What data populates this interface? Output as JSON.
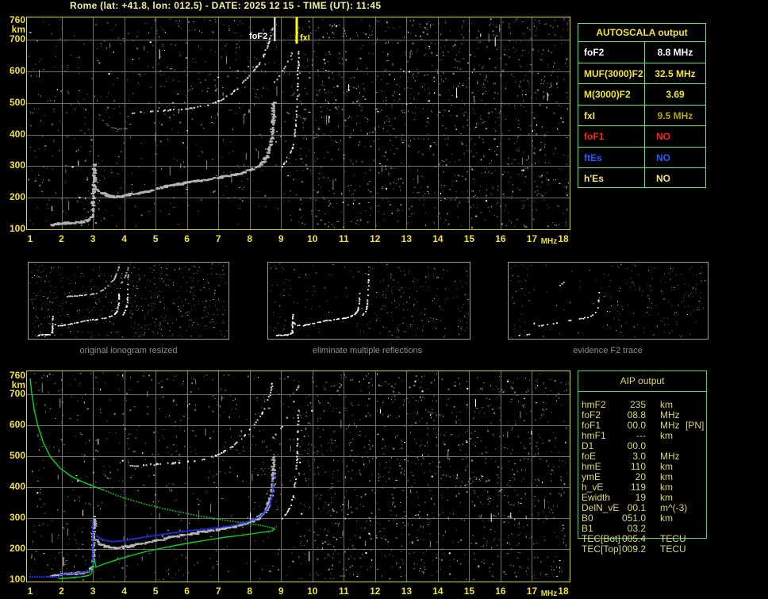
{
  "title": "Rome (lat: +41.8, lon: 012.5) - DATE: 2025 12 15 - TIME (UT): 11:45",
  "colors": {
    "tick_yellow": "#f0e23a",
    "title_yellow": "#f5f1a2",
    "plot_border": "#d8d800",
    "grid": "#6f6f6f",
    "white": "#ffffff",
    "red": "#ff2020",
    "blue": "#2060ff",
    "olive_value": "#b4a800",
    "pale_yellow": "#f0e87c",
    "khaki": "#d9d973",
    "green_curve": "#00d81e",
    "blue_trace": "#2233ee",
    "noise_gray": "#767676",
    "noise_light": "#9c9c9c",
    "caption_gray": "#8f8f8f",
    "thumb_border": "#9a9a9a",
    "autoscala_border": "#57e57c",
    "aip_border": "#3fdd6f",
    "marker_foF2": "#ffffff",
    "marker_fxI": "#ffff00"
  },
  "axes": {
    "freq_unit": "MHz",
    "height_unit": "km",
    "freq_ticks": [
      "1",
      "2",
      "3",
      "4",
      "5",
      "6",
      "7",
      "8",
      "9",
      "10",
      "11",
      "12",
      "13",
      "14",
      "15",
      "16",
      "17",
      "18"
    ],
    "height_ticks": [
      "760",
      "700",
      "600",
      "500",
      "400",
      "300",
      "200",
      "100"
    ],
    "freq_range_MHz": [
      1,
      18
    ],
    "height_range_km": [
      100,
      760
    ]
  },
  "top_plot": {
    "foF2_marker_label": "foF2",
    "fxI_marker_label": "fxI",
    "foF2_MHz": 8.8,
    "fxI_MHz": 9.5
  },
  "autoscala_table": {
    "title": "AUTOSCALA output",
    "rows": [
      {
        "label": "foF2",
        "value": "8.8 MHz",
        "label_color": "#ffffff",
        "value_color": "#ffffff",
        "no": false
      },
      {
        "label": "MUF(3000)F2",
        "value": "32.5 MHz",
        "label_color": "#f2e43a",
        "value_color": "#f2e43a",
        "no": false
      },
      {
        "label": "M(3000)F2",
        "value": "3.69",
        "label_color": "#f2e43a",
        "value_color": "#f2e43a",
        "no": false
      },
      {
        "label": "fxI",
        "value": "9.5 MHz",
        "label_color": "#f2e43a",
        "value_color": "#b4a800",
        "no": false
      },
      {
        "label": "foF1",
        "value": "NO",
        "label_color": "#ff2020",
        "value_color": "#ff2020",
        "no": true
      },
      {
        "label": "ftEs",
        "value": "NO",
        "label_color": "#2060ff",
        "value_color": "#2060ff",
        "no": true
      },
      {
        "label": "h'Es",
        "value": "NO",
        "label_color": "#f0e87c",
        "value_color": "#f0e87c",
        "no": true
      }
    ]
  },
  "thumbnails": [
    {
      "caption": "original ionogram resized"
    },
    {
      "caption": "eliminate multiple reflections"
    },
    {
      "caption": "evidence F2 trace"
    }
  ],
  "aip_table": {
    "title": "AIP output",
    "rows": [
      {
        "label": "hmF2",
        "value": "235",
        "unit": "km",
        "note": ""
      },
      {
        "label": "foF2",
        "value": "08.8",
        "unit": "MHz",
        "note": ""
      },
      {
        "label": "foF1",
        "value": "00.0",
        "unit": "MHz",
        "note": "[PN]"
      },
      {
        "label": "hmF1",
        "value": "---",
        "unit": "km",
        "note": ""
      },
      {
        "label": "D1",
        "value": "00.0",
        "unit": "",
        "note": ""
      },
      {
        "label": "foE",
        "value": "3.0",
        "unit": "MHz",
        "note": ""
      },
      {
        "label": "hmE",
        "value": "110",
        "unit": "km",
        "note": ""
      },
      {
        "label": "ymE",
        "value": "20",
        "unit": "km",
        "note": ""
      },
      {
        "label": "h_vE",
        "value": "119",
        "unit": "km",
        "note": ""
      },
      {
        "label": "Ewidth",
        "value": "19",
        "unit": "km",
        "note": ""
      },
      {
        "label": "DelN_vE",
        "value": "00.1",
        "unit": "m^(-3)",
        "note": ""
      },
      {
        "label": "B0",
        "value": "051.0",
        "unit": "km",
        "note": ""
      },
      {
        "label": "B1",
        "value": "03.2",
        "unit": "",
        "note": ""
      },
      {
        "label": "TEC[Bot]",
        "value": "005.4",
        "unit": "TECU",
        "note": ""
      },
      {
        "label": "TEC[Top]",
        "value": "009.2",
        "unit": "TECU",
        "note": ""
      }
    ]
  },
  "ionogram_traces": {
    "E": [
      [
        1.7,
        112
      ],
      [
        1.85,
        117
      ],
      [
        2.1,
        119
      ],
      [
        2.4,
        121
      ],
      [
        2.65,
        122
      ],
      [
        2.85,
        127
      ],
      [
        2.95,
        140
      ]
    ],
    "cusp": [
      [
        3.01,
        142
      ],
      [
        3.02,
        185
      ],
      [
        3.03,
        235
      ],
      [
        3.05,
        280
      ],
      [
        3.07,
        306
      ]
    ],
    "F": [
      [
        3.1,
        232
      ],
      [
        3.25,
        216
      ],
      [
        3.45,
        207
      ],
      [
        3.7,
        203
      ],
      [
        3.95,
        205
      ],
      [
        4.2,
        210
      ],
      [
        4.6,
        218
      ],
      [
        5.0,
        227
      ],
      [
        5.4,
        236
      ],
      [
        5.8,
        244
      ],
      [
        6.2,
        251
      ],
      [
        6.6,
        257
      ],
      [
        7.0,
        263
      ],
      [
        7.4,
        270
      ],
      [
        7.8,
        280
      ],
      [
        8.1,
        291
      ],
      [
        8.35,
        305
      ],
      [
        8.52,
        323
      ],
      [
        8.63,
        347
      ],
      [
        8.7,
        380
      ],
      [
        8.74,
        420
      ],
      [
        8.76,
        462
      ],
      [
        8.77,
        500
      ]
    ],
    "FX": [
      [
        9.05,
        300
      ],
      [
        9.2,
        318
      ],
      [
        9.32,
        343
      ],
      [
        9.41,
        378
      ],
      [
        9.47,
        425
      ],
      [
        9.51,
        480
      ],
      [
        9.53,
        540
      ],
      [
        9.55,
        608
      ],
      [
        9.56,
        662
      ]
    ],
    "hop2O": [
      [
        4.2,
        468
      ],
      [
        4.7,
        472
      ],
      [
        5.2,
        475
      ],
      [
        5.7,
        479
      ],
      [
        6.1,
        483
      ],
      [
        6.5,
        489
      ],
      [
        6.8,
        497
      ],
      [
        7.1,
        510
      ],
      [
        7.4,
        528
      ],
      [
        7.7,
        553
      ],
      [
        8.0,
        585
      ],
      [
        8.3,
        622
      ],
      [
        8.5,
        660
      ],
      [
        8.65,
        700
      ],
      [
        8.72,
        735
      ]
    ],
    "hop2X": [
      [
        8.75,
        560
      ],
      [
        8.95,
        585
      ],
      [
        9.15,
        615
      ],
      [
        9.32,
        650
      ],
      [
        9.45,
        690
      ],
      [
        9.55,
        728
      ]
    ],
    "hop2E": [
      [
        3.2,
        462
      ],
      [
        3.35,
        440
      ],
      [
        3.55,
        425
      ],
      [
        3.8,
        416
      ],
      [
        4.05,
        418
      ],
      [
        4.2,
        432
      ]
    ]
  },
  "profile_curves": {
    "upper_solid": [
      [
        1.0,
        752
      ],
      [
        1.05,
        705
      ],
      [
        1.13,
        652
      ],
      [
        1.25,
        598
      ],
      [
        1.42,
        545
      ],
      [
        1.65,
        498
      ],
      [
        1.95,
        462
      ],
      [
        2.3,
        436
      ],
      [
        2.7,
        416
      ],
      [
        3.1,
        400
      ],
      [
        3.35,
        391
      ]
    ],
    "upper_dotted": [
      [
        3.35,
        391
      ],
      [
        3.8,
        372
      ],
      [
        4.3,
        356
      ],
      [
        4.8,
        342
      ],
      [
        5.3,
        330
      ],
      [
        5.8,
        319
      ],
      [
        6.3,
        309
      ],
      [
        6.8,
        300
      ],
      [
        7.3,
        292
      ],
      [
        7.8,
        285
      ],
      [
        8.2,
        279
      ],
      [
        8.5,
        274
      ],
      [
        8.7,
        269
      ],
      [
        8.78,
        265
      ]
    ],
    "lower_solid": [
      [
        8.78,
        265
      ],
      [
        8.72,
        259
      ],
      [
        8.45,
        255
      ],
      [
        8.1,
        250
      ],
      [
        7.7,
        244
      ],
      [
        7.2,
        238
      ],
      [
        6.7,
        230
      ],
      [
        6.2,
        222
      ],
      [
        5.7,
        213
      ],
      [
        5.2,
        203
      ],
      [
        4.7,
        192
      ],
      [
        4.25,
        180
      ],
      [
        3.85,
        168
      ],
      [
        3.5,
        157
      ],
      [
        3.25,
        148
      ],
      [
        3.1,
        141
      ],
      [
        3.05,
        166
      ],
      [
        3.0,
        148
      ],
      [
        2.96,
        121
      ],
      [
        2.85,
        114
      ],
      [
        2.6,
        110
      ],
      [
        2.3,
        107
      ],
      [
        2.0,
        105
      ],
      [
        1.9,
        104
      ]
    ]
  },
  "scaled_trace_blue": {
    "flat": [
      [
        1.0,
        110
      ],
      [
        1.9,
        110
      ]
    ],
    "E": [
      [
        1.95,
        116
      ],
      [
        2.2,
        120
      ],
      [
        2.5,
        122
      ],
      [
        2.75,
        125
      ],
      [
        2.9,
        130
      ]
    ],
    "cusp_f": 3.0,
    "cusp_h_range": [
      150,
      295
    ],
    "F": [
      [
        3.12,
        242
      ],
      [
        3.3,
        231
      ],
      [
        3.6,
        224
      ],
      [
        3.9,
        226
      ],
      [
        4.2,
        231
      ],
      [
        4.6,
        238
      ],
      [
        5.0,
        244
      ],
      [
        5.4,
        250
      ],
      [
        5.8,
        256
      ],
      [
        6.2,
        261
      ],
      [
        6.6,
        265
      ],
      [
        7.0,
        269
      ],
      [
        7.4,
        275
      ],
      [
        7.8,
        284
      ],
      [
        8.1,
        294
      ],
      [
        8.35,
        307
      ],
      [
        8.52,
        324
      ],
      [
        8.65,
        348
      ],
      [
        8.72,
        377
      ],
      [
        8.75,
        408
      ]
    ],
    "tips": [
      [
        8.78,
        437
      ]
    ]
  }
}
